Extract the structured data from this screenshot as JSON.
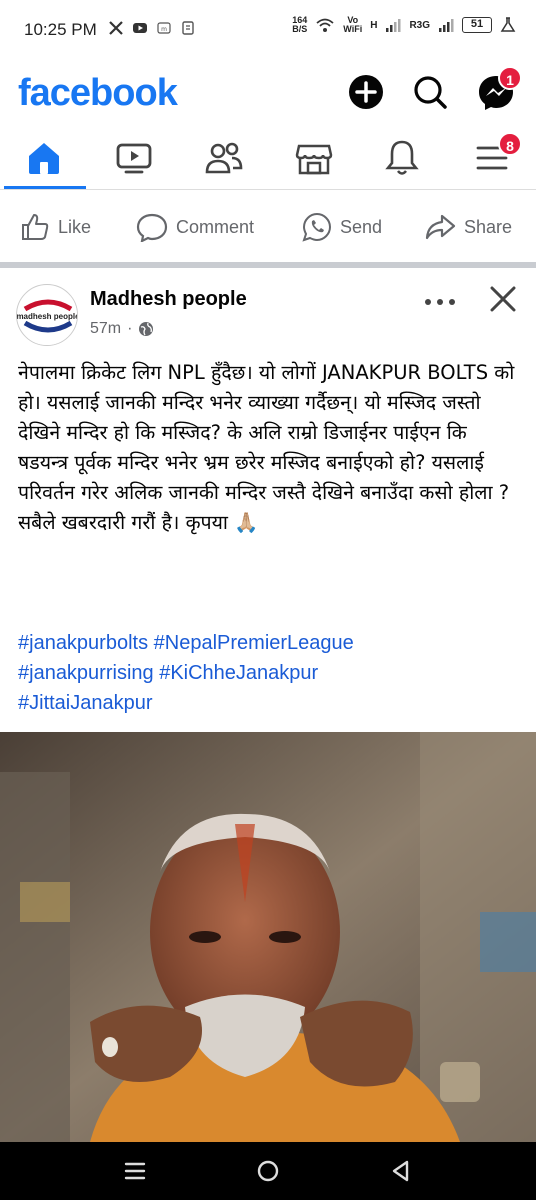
{
  "status_bar": {
    "time": "10:25 PM",
    "speed_value": "164",
    "speed_unit": "B/S",
    "vo": "Vo",
    "wifi": "WiFi",
    "h_label": "H",
    "r3g_label": "R3G",
    "battery": "51"
  },
  "header": {
    "logo": "facebook",
    "messenger_badge": "1"
  },
  "tabs": {
    "menu_badge": "8"
  },
  "actions": {
    "like": "Like",
    "comment": "Comment",
    "send": "Send",
    "share": "Share"
  },
  "post": {
    "author": "Madhesh people",
    "avatar_text": "madhesh people",
    "time": "57m",
    "text": "नेपालमा क्रिकेट लिग NPL हुँदैछ। यो लोगों JANAKPUR BOLTS को हो। यसलाई जानकी मन्दिर भनेर व्याख्या गर्दैछन्। यो मस्जिद जस्तो देखिने मन्दिर हो कि मस्जिद? के अलि राम्रो डिजाईनर पाईएन कि षडयन्त्र पूर्वक मन्दिर भनेर भ्रम छरेर मस्जिद बनाईएको हो? यसलाई परिवर्तन गरेर अलिक जानकी मन्दिर जस्तै देखिने बनाउँदा कसो होला ? सबैले खबरदारी गरौं है। कृपया 🙏🏼",
    "hashtags": [
      "#janakpurbolts",
      "#NepalPremierLeague",
      "#janakpurrising",
      "#KiChheJanakpur",
      "#JittaiJanakpur"
    ]
  },
  "colors": {
    "brand": "#1877f2",
    "badge": "#e41e3f",
    "hashtag": "#1a5bd6",
    "muted": "#65676b"
  }
}
